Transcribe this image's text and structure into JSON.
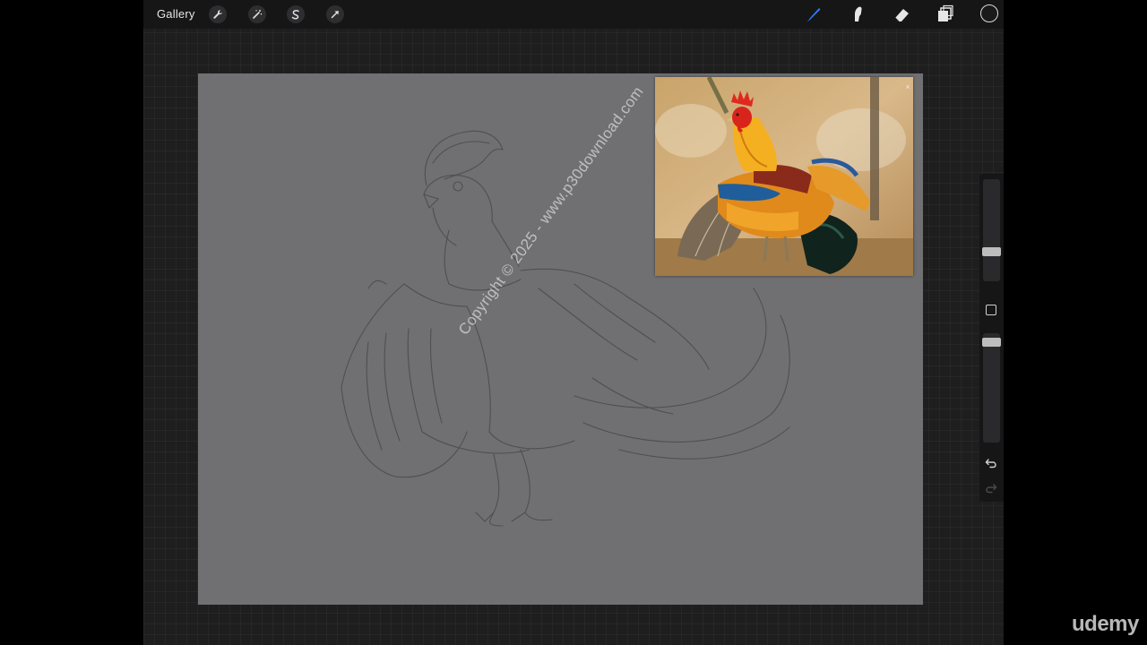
{
  "toolbar": {
    "gallery_label": "Gallery",
    "left_tools": [
      "wrench-icon",
      "magic-wand-icon",
      "selection-icon",
      "transform-arrow-icon"
    ],
    "right_tools": [
      "brush-icon",
      "smudge-icon",
      "eraser-icon",
      "layers-icon"
    ],
    "active_tool": "brush-icon",
    "accent_color": "#2f7bff",
    "current_color": "#1a1a1a"
  },
  "canvas": {
    "watermark_text": "Copyright © 2025 - www.p30download.com",
    "background_color": "#707072",
    "reference_image": {
      "subject": "rooster photo",
      "close_label": "×"
    }
  },
  "sidebar": {
    "brush_size_level": 0.75,
    "opacity_level": 0.9,
    "undo_icon": "undo-icon",
    "redo_icon": "redo-icon"
  },
  "branding": {
    "udemy_logo_text": "udemy"
  }
}
